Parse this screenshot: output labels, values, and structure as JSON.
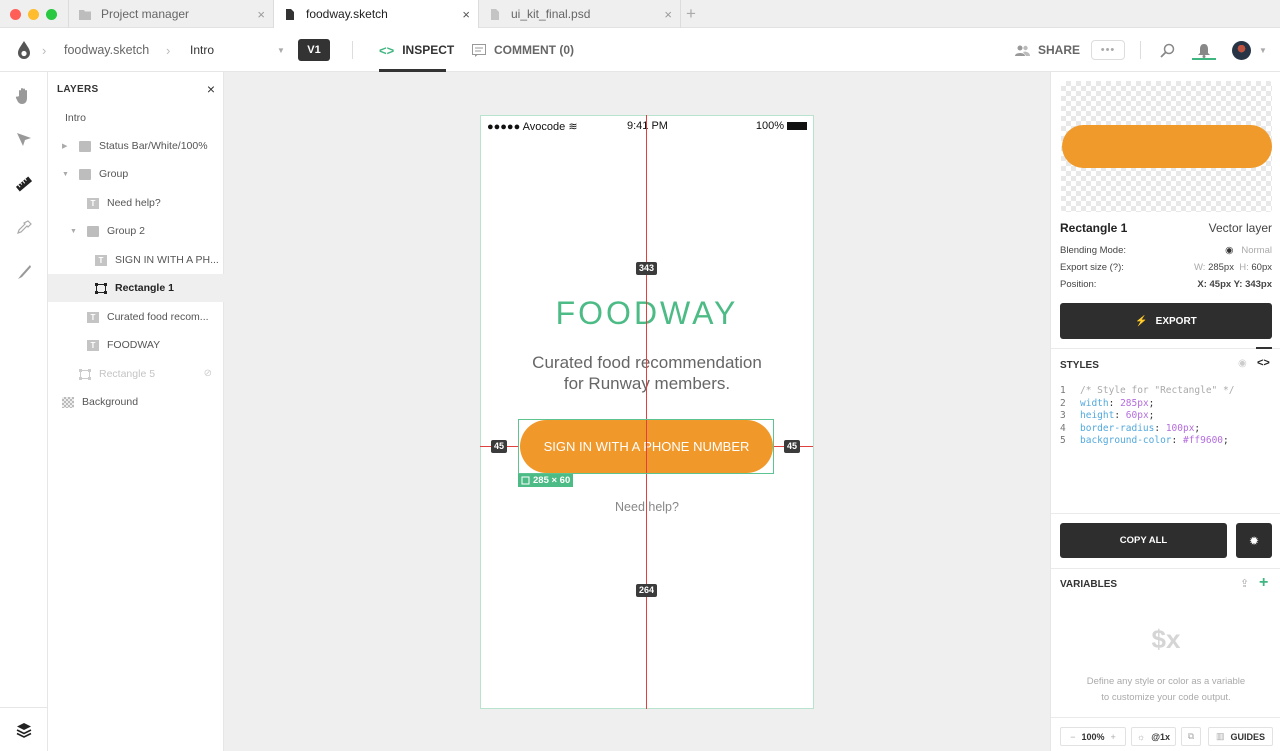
{
  "window": {
    "traffic_lights": [
      "#ff5f57",
      "#febc2e",
      "#28c840"
    ]
  },
  "tabs": [
    {
      "label": "Project manager",
      "icon": "folder-icon",
      "active": false
    },
    {
      "label": "foodway.sketch",
      "icon": "file-icon",
      "active": true
    },
    {
      "label": "ui_kit_final.psd",
      "icon": "file-icon",
      "active": false
    }
  ],
  "tab_close": "×",
  "tab_add": "+",
  "toolbar": {
    "breadcrumb": {
      "file": "foodway.sketch",
      "artboard": "Intro",
      "sep": "›"
    },
    "version": "V1",
    "inspect_label": "INSPECT",
    "comment_label": "COMMENT (0)",
    "share_label": "SHARE",
    "more_label": "•••"
  },
  "layers": {
    "title": "LAYERS",
    "close": "×",
    "items": [
      {
        "label": "Intro"
      },
      {
        "label": "Status Bar/White/100%"
      },
      {
        "label": "Group"
      },
      {
        "label": "Need help?"
      },
      {
        "label": "Group 2"
      },
      {
        "label": "SIGN IN WITH A PH..."
      },
      {
        "label": "Rectangle 1"
      },
      {
        "label": "Curated food recom..."
      },
      {
        "label": "FOODWAY"
      },
      {
        "label": "Rectangle 5"
      },
      {
        "label": "Background"
      }
    ]
  },
  "artboard": {
    "status_carrier": "●●●●● Avocode",
    "status_time": "9:41 PM",
    "status_battery": "100%",
    "logo": "FOODWAY",
    "tagline_line1": "Curated food recommendation",
    "tagline_line2": "for Runway members.",
    "cta": "SIGN IN WITH A PHONE NUMBER",
    "need_help": "Need help?",
    "measure_top": "343",
    "measure_bottom": "264",
    "measure_left": "45",
    "measure_right": "45",
    "selection_size": "285 × 60",
    "accent": "#4dbb85",
    "button_color": "#f0982a"
  },
  "inspector": {
    "layer_name": "Rectangle 1",
    "layer_type": "Vector layer",
    "blending_label": "Blending Mode:",
    "blending_value": "Normal",
    "export_size_label": "Export size (?):",
    "w_label": "W:",
    "w_value": "285px",
    "h_label": "H:",
    "h_value": "60px",
    "position_label": "Position:",
    "x_label": "X:",
    "x_value": "45px",
    "y_label": "Y:",
    "y_value": "343px",
    "export_label": "EXPORT",
    "styles_title": "STYLES",
    "code": [
      {
        "n": "1",
        "comment": "/* Style for \"Rectangle\" */"
      },
      {
        "n": "2",
        "key": "width",
        "value": "285px"
      },
      {
        "n": "3",
        "key": "height",
        "value": "60px"
      },
      {
        "n": "4",
        "key": "border-radius",
        "value": "100px"
      },
      {
        "n": "5",
        "key": "background-color",
        "value": "#ff9600"
      }
    ],
    "copy_all": "COPY ALL",
    "variables_title": "VARIABLES",
    "variables_symbol": "$x",
    "variables_desc_1": "Define any style or color as a variable",
    "variables_desc_2": "to customize your code output.",
    "zoom_minus": "−",
    "zoom_value": "100%",
    "zoom_plus": "+",
    "scale_value": "@1x",
    "guides_label": "GUIDES"
  }
}
